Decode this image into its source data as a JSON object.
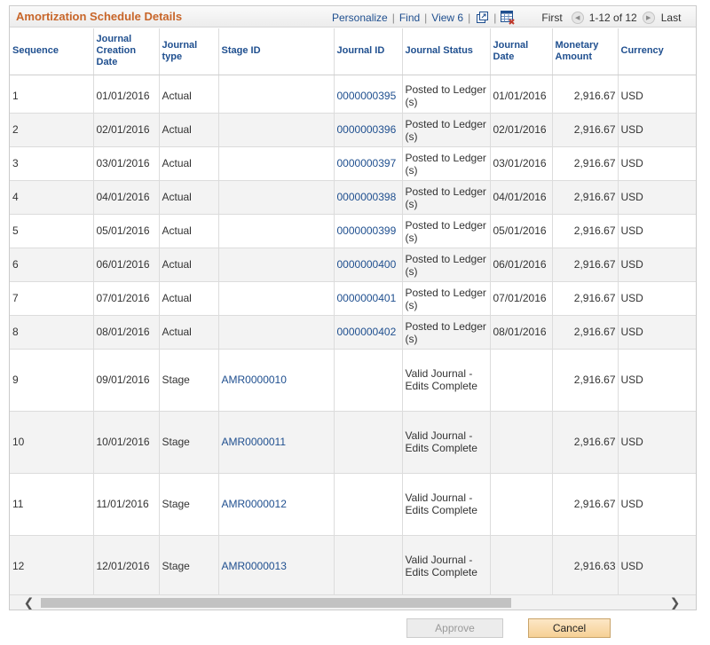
{
  "grid": {
    "title": "Amortization Schedule Details",
    "toolbar": {
      "personalize": "Personalize",
      "find": "Find",
      "view": "View 6",
      "separator": "|",
      "first": "First",
      "range": "1-12 of 12",
      "last": "Last"
    },
    "headers": {
      "sequence": "Sequence",
      "creation_date": "Journal Creation Date",
      "journal_type": "Journal type",
      "stage_id": "Stage ID",
      "journal_id": "Journal ID",
      "journal_status": "Journal Status",
      "journal_date": "Journal Date",
      "monetary_amount": "Monetary Amount",
      "currency": "Currency"
    },
    "rows": [
      {
        "seq": "1",
        "created": "01/01/2016",
        "type": "Actual",
        "stage_id": "",
        "journal_id": "0000000395",
        "status": "Posted to Ledger (s)",
        "jdate": "01/01/2016",
        "amount": "2,916.67",
        "currency": "USD"
      },
      {
        "seq": "2",
        "created": "02/01/2016",
        "type": "Actual",
        "stage_id": "",
        "journal_id": "0000000396",
        "status": "Posted to Ledger (s)",
        "jdate": "02/01/2016",
        "amount": "2,916.67",
        "currency": "USD"
      },
      {
        "seq": "3",
        "created": "03/01/2016",
        "type": "Actual",
        "stage_id": "",
        "journal_id": "0000000397",
        "status": "Posted to Ledger (s)",
        "jdate": "03/01/2016",
        "amount": "2,916.67",
        "currency": "USD"
      },
      {
        "seq": "4",
        "created": "04/01/2016",
        "type": "Actual",
        "stage_id": "",
        "journal_id": "0000000398",
        "status": "Posted to Ledger (s)",
        "jdate": "04/01/2016",
        "amount": "2,916.67",
        "currency": "USD"
      },
      {
        "seq": "5",
        "created": "05/01/2016",
        "type": "Actual",
        "stage_id": "",
        "journal_id": "0000000399",
        "status": "Posted to Ledger (s)",
        "jdate": "05/01/2016",
        "amount": "2,916.67",
        "currency": "USD"
      },
      {
        "seq": "6",
        "created": "06/01/2016",
        "type": "Actual",
        "stage_id": "",
        "journal_id": "0000000400",
        "status": "Posted to Ledger (s)",
        "jdate": "06/01/2016",
        "amount": "2,916.67",
        "currency": "USD"
      },
      {
        "seq": "7",
        "created": "07/01/2016",
        "type": "Actual",
        "stage_id": "",
        "journal_id": "0000000401",
        "status": "Posted to Ledger (s)",
        "jdate": "07/01/2016",
        "amount": "2,916.67",
        "currency": "USD"
      },
      {
        "seq": "8",
        "created": "08/01/2016",
        "type": "Actual",
        "stage_id": "",
        "journal_id": "0000000402",
        "status": "Posted to Ledger (s)",
        "jdate": "08/01/2016",
        "amount": "2,916.67",
        "currency": "USD"
      },
      {
        "seq": "9",
        "created": "09/01/2016",
        "type": "Stage",
        "stage_id": "AMR0000010",
        "journal_id": "",
        "status": "Valid Journal - Edits Complete",
        "jdate": "",
        "amount": "2,916.67",
        "currency": "USD"
      },
      {
        "seq": "10",
        "created": "10/01/2016",
        "type": "Stage",
        "stage_id": "AMR0000011",
        "journal_id": "",
        "status": "Valid Journal - Edits Complete",
        "jdate": "",
        "amount": "2,916.67",
        "currency": "USD"
      },
      {
        "seq": "11",
        "created": "11/01/2016",
        "type": "Stage",
        "stage_id": "AMR0000012",
        "journal_id": "",
        "status": "Valid Journal - Edits Complete",
        "jdate": "",
        "amount": "2,916.67",
        "currency": "USD"
      },
      {
        "seq": "12",
        "created": "12/01/2016",
        "type": "Stage",
        "stage_id": "AMR0000013",
        "journal_id": "",
        "status": "Valid Journal - Edits Complete",
        "jdate": "",
        "amount": "2,916.63",
        "currency": "USD"
      }
    ]
  },
  "scrollbar": {
    "left_arrow": "❮",
    "right_arrow": "❯"
  },
  "buttons": {
    "approve": "Approve",
    "cancel": "Cancel"
  },
  "icons": {
    "zoom": "new-window-icon",
    "download": "download-to-spreadsheet-icon",
    "first": "previous-arrow-icon",
    "last": "next-arrow-icon"
  },
  "colors": {
    "title": "#c8662a",
    "link": "#1f4f8f",
    "cancel_button": "#f6d095",
    "alt_row": "#f3f3f3"
  }
}
